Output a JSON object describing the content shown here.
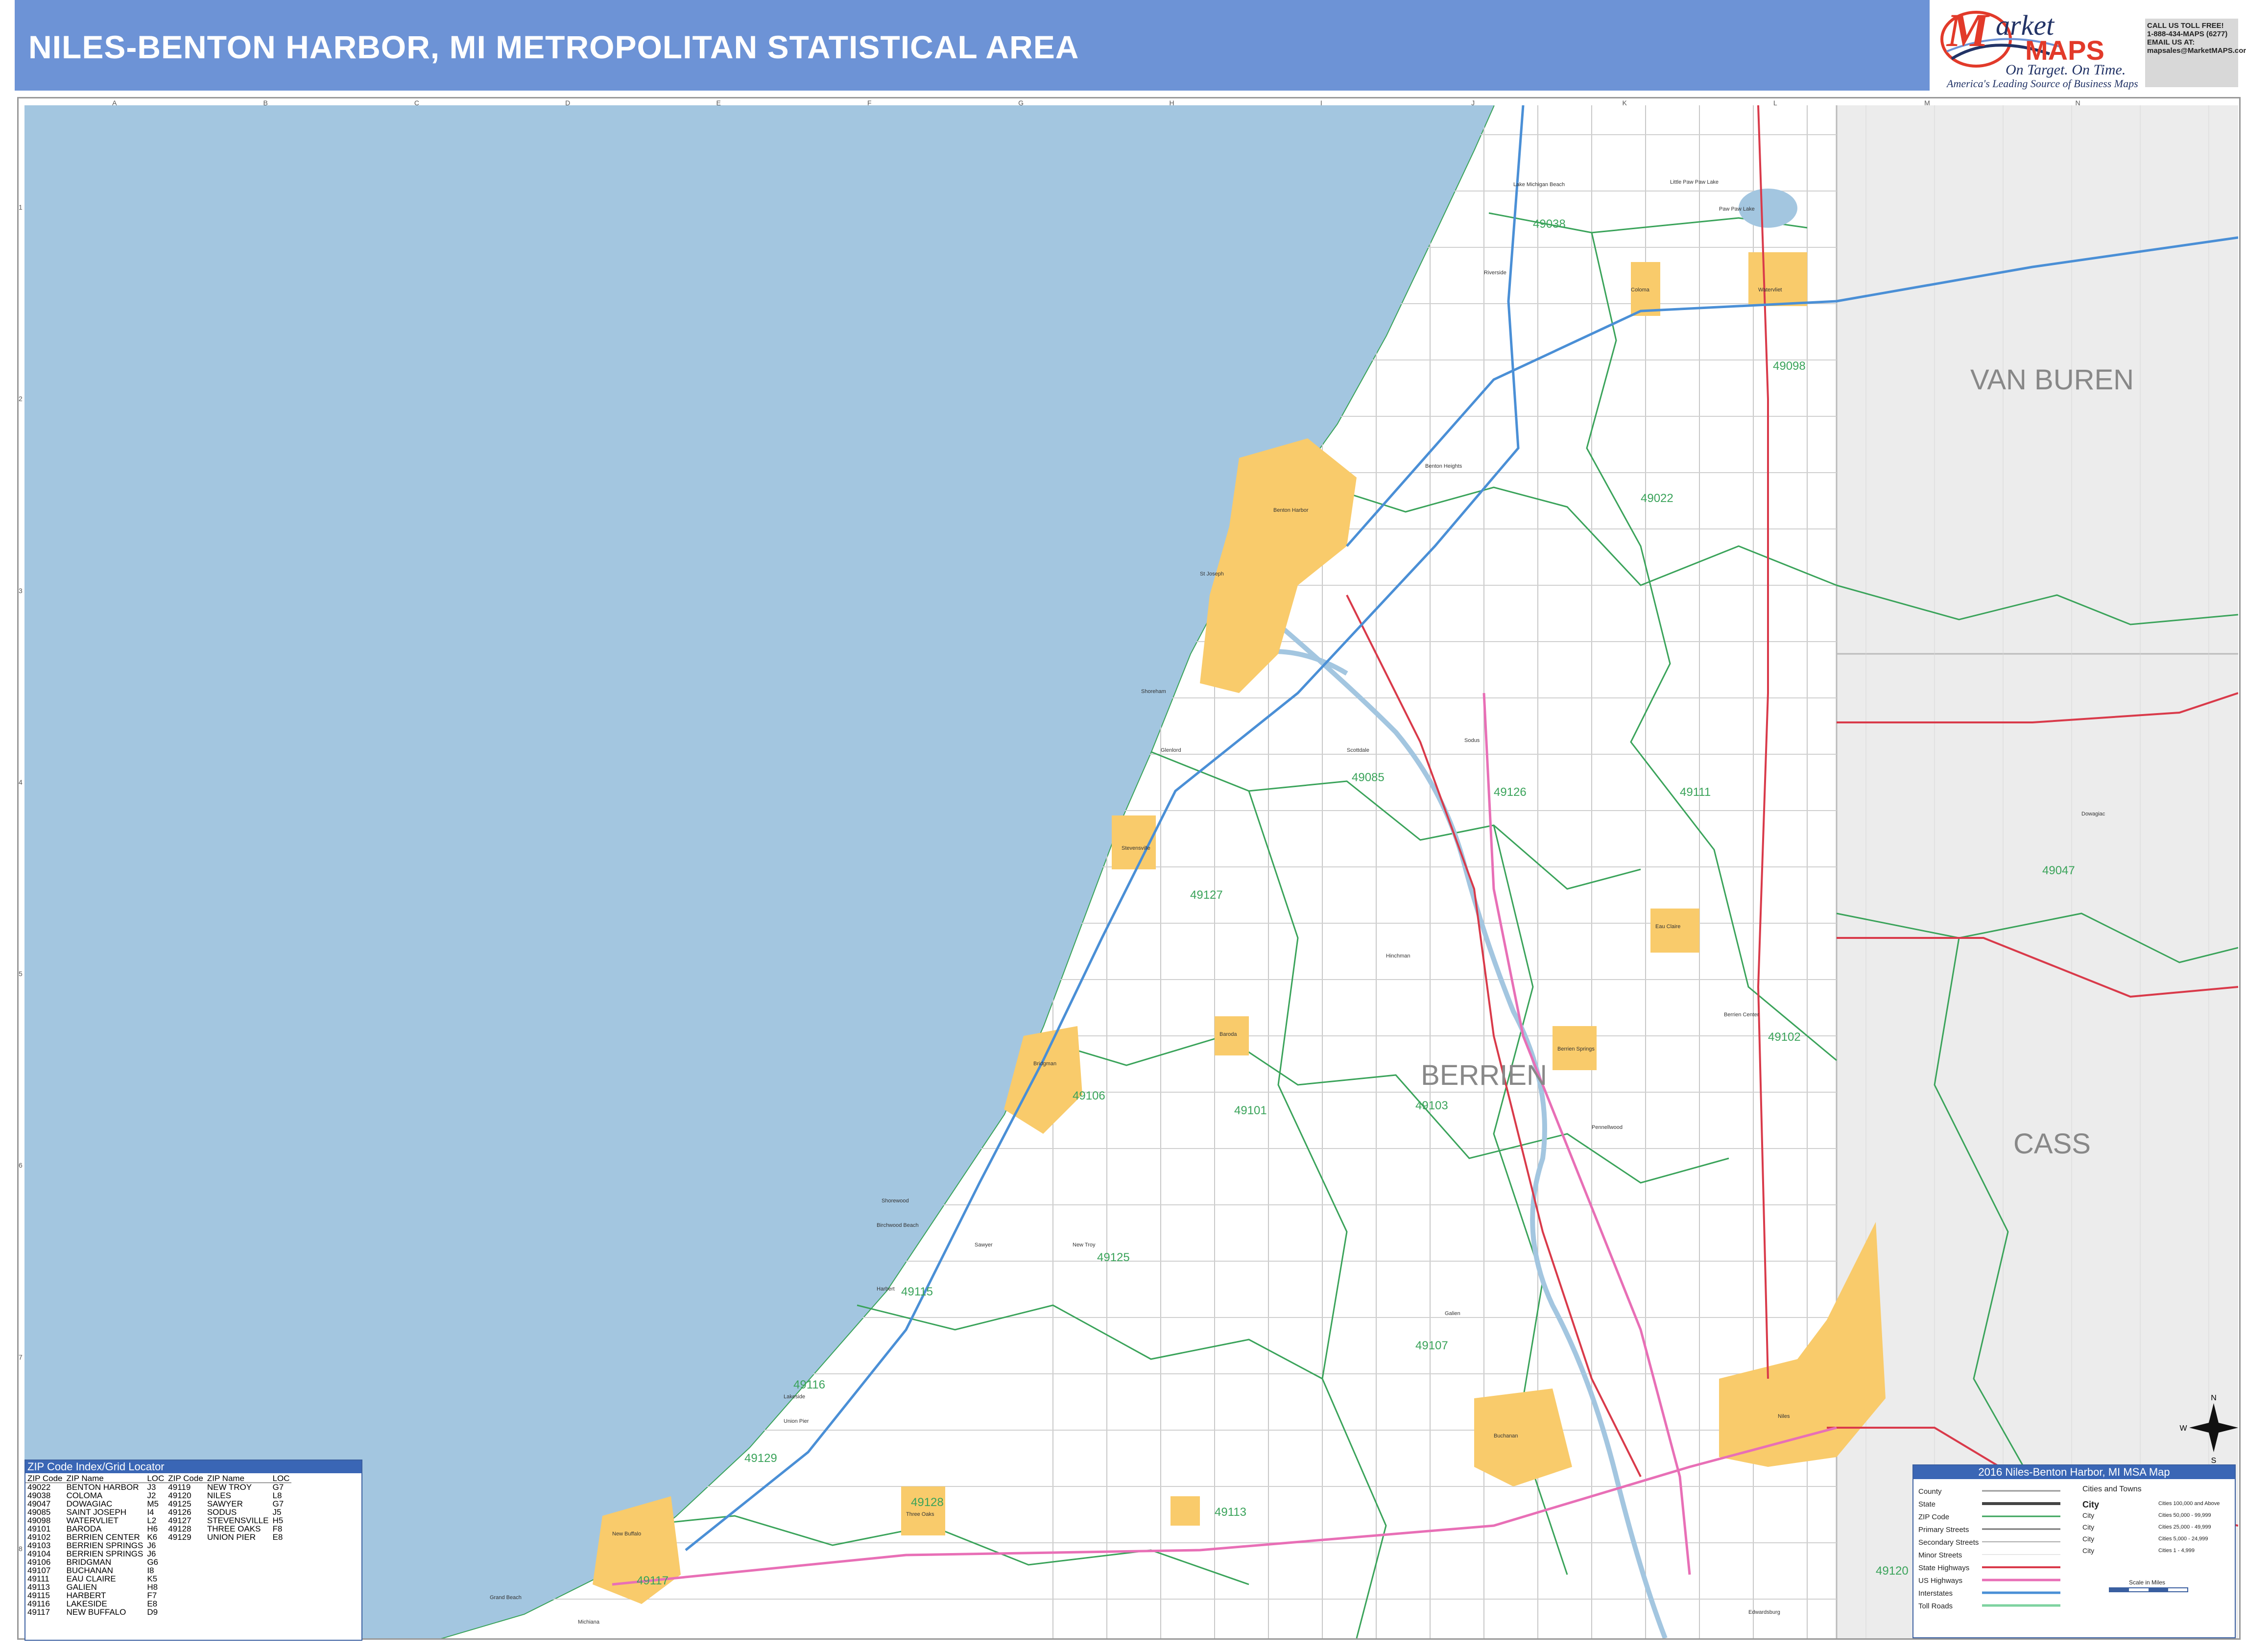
{
  "header": {
    "title": "NILES-BENTON HARBOR, MI METROPOLITAN STATISTICAL AREA"
  },
  "logo": {
    "mark": "M",
    "word1": "arket",
    "word2": "MAPS",
    "tagline": "On Target. On Time.",
    "subtitle": "America's Leading Source of Business Maps",
    "contact": [
      "CALL US TOLL FREE!",
      "1-888-434-MAPS (6277)",
      "EMAIL US AT:",
      "mapsales@MarketMAPS.com"
    ]
  },
  "grid": {
    "columns": [
      "A",
      "B",
      "C",
      "D",
      "E",
      "F",
      "G",
      "H",
      "I",
      "J",
      "K",
      "L",
      "M",
      "N"
    ],
    "rows": [
      "1",
      "2",
      "3",
      "4",
      "5",
      "6",
      "7",
      "8"
    ]
  },
  "colors": {
    "water": "#a3c6e0",
    "land": "#ffffff",
    "outside_county": "#ececec",
    "city": "#f9cb6b",
    "zip_line": "#3aa35a",
    "state_highway": "#d93a4a",
    "us_highway": "#e86fb6",
    "interstate": "#4a8fd6",
    "streets": "#b5b5b5",
    "header": "#6d93d6",
    "zip_label": "#3aa35a"
  },
  "map": {
    "counties": [
      "VAN BUREN",
      "BERRIEN",
      "CASS"
    ],
    "zip_labels": [
      "49038",
      "49098",
      "49022",
      "49126",
      "49111",
      "49085",
      "49127",
      "49047",
      "49102",
      "49106",
      "49101",
      "49103",
      "49125",
      "49115",
      "49107",
      "49116",
      "49129",
      "49128",
      "49113",
      "49117",
      "49120"
    ],
    "places": [
      "Benton Heights",
      "Benton Harbor",
      "St Joseph",
      "Coloma",
      "Watervliet",
      "Paw Paw Lake",
      "Little Paw Paw Lake",
      "Lake Michigan Beach",
      "Riverside",
      "Shoreham",
      "Glenlord",
      "Stevensville",
      "Scottdale",
      "Sodus",
      "Eau Claire",
      "Hinchman",
      "Bridgman",
      "Berrien Springs",
      "Pennellwood",
      "Berrien Center",
      "Baroda",
      "Sawyer",
      "Galien",
      "Shorewood",
      "Birchwood Beach",
      "Harbert",
      "Union Pier",
      "Lakeside",
      "Three Oaks",
      "New Troy",
      "Buchanan",
      "Niles",
      "Grand Beach",
      "New Buffalo",
      "Michiana",
      "Edwardsburg",
      "Dowagiac"
    ]
  },
  "zip_index": {
    "title": "ZIP Code Index/Grid Locator",
    "headers": [
      "ZIP Code",
      "ZIP Name",
      "LOC",
      "ZIP Code",
      "ZIP Name",
      "LOC"
    ],
    "left": [
      [
        "49022",
        "BENTON HARBOR",
        "J3"
      ],
      [
        "49038",
        "COLOMA",
        "J2"
      ],
      [
        "49047",
        "DOWAGIAC",
        "M5"
      ],
      [
        "49085",
        "SAINT JOSEPH",
        "I4"
      ],
      [
        "49098",
        "WATERVLIET",
        "L2"
      ],
      [
        "49101",
        "BARODA",
        "H6"
      ],
      [
        "49102",
        "BERRIEN CENTER",
        "K6"
      ],
      [
        "49103",
        "BERRIEN SPRINGS",
        "J6"
      ],
      [
        "49104",
        "BERRIEN SPRINGS",
        "J6"
      ],
      [
        "49106",
        "BRIDGMAN",
        "G6"
      ],
      [
        "49107",
        "BUCHANAN",
        "I8"
      ],
      [
        "49111",
        "EAU CLAIRE",
        "K5"
      ],
      [
        "49113",
        "GALIEN",
        "H8"
      ],
      [
        "49115",
        "HARBERT",
        "F7"
      ],
      [
        "49116",
        "LAKESIDE",
        "E8"
      ],
      [
        "49117",
        "NEW BUFFALO",
        "D9"
      ]
    ],
    "right": [
      [
        "49119",
        "NEW TROY",
        "G7"
      ],
      [
        "49120",
        "NILES",
        "L8"
      ],
      [
        "49125",
        "SAWYER",
        "G7"
      ],
      [
        "49126",
        "SODUS",
        "J5"
      ],
      [
        "49127",
        "STEVENSVILLE",
        "H5"
      ],
      [
        "49128",
        "THREE OAKS",
        "F8"
      ],
      [
        "49129",
        "UNION PIER",
        "E8"
      ]
    ]
  },
  "legend": {
    "title": "2016 Niles-Benton Harbor, MI MSA Map",
    "items": [
      "County",
      "State",
      "ZIP Code",
      "Primary Streets",
      "Secondary Streets",
      "Minor Streets",
      "State Highways",
      "US Highways",
      "Interstates",
      "Toll Roads"
    ],
    "cities_title": "Cities and Towns",
    "city_sizes": [
      [
        "City",
        "Cities 100,000 and Above"
      ],
      [
        "City",
        "Cities 50,000 - 99,999"
      ],
      [
        "City",
        "Cities 25,000 - 49,999"
      ],
      [
        "City",
        "Cities 5,000 - 24,999"
      ],
      [
        "City",
        "Cities 1 - 4,999"
      ]
    ],
    "scale": "Scale in Miles"
  },
  "compass": {
    "n": "N",
    "s": "S",
    "e": "E",
    "w": "W"
  }
}
